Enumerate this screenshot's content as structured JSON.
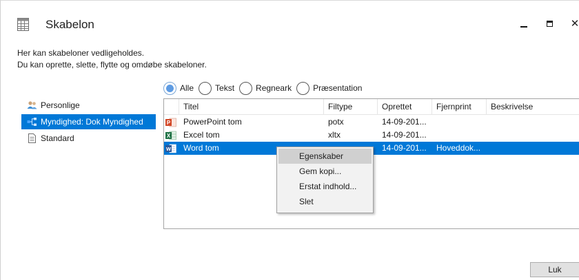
{
  "window": {
    "title": "Skabelon",
    "icon": "template-grid-icon",
    "controls": {
      "minimize": "minimize-icon",
      "maximize": "maximize-icon",
      "close": "✕"
    }
  },
  "intro": {
    "line1": "Her kan skabeloner vedligeholdes.",
    "line2": "Du kan oprette, slette, flytte og omdøbe skabeloner."
  },
  "filters": {
    "options": [
      {
        "label": "Alle",
        "checked": true
      },
      {
        "label": "Tekst",
        "checked": false
      },
      {
        "label": "Regneark",
        "checked": false
      },
      {
        "label": "Præsentation",
        "checked": false
      }
    ]
  },
  "tree": {
    "items": [
      {
        "label": "Personlige",
        "icon": "users-icon",
        "selected": false
      },
      {
        "label": "Myndighed: Dok Myndighed",
        "icon": "org-network-icon",
        "selected": true
      },
      {
        "label": "Standard",
        "icon": "document-icon",
        "selected": false
      }
    ]
  },
  "table": {
    "columns": [
      "Titel",
      "Filtype",
      "Oprettet",
      "Fjernprint",
      "Beskrivelse"
    ],
    "rows": [
      {
        "icon": "powerpoint-icon",
        "title": "PowerPoint tom",
        "type": "potx",
        "created": "14-09-201...",
        "remote": "",
        "description": "",
        "selected": false
      },
      {
        "icon": "excel-icon",
        "title": "Excel tom",
        "type": "xltx",
        "created": "14-09-201...",
        "remote": "",
        "description": "",
        "selected": false
      },
      {
        "icon": "word-icon",
        "title": "Word tom",
        "type": "",
        "created": "14-09-201...",
        "remote": "Hoveddok...",
        "description": "",
        "selected": true
      }
    ]
  },
  "context_menu": {
    "items": [
      {
        "label": "Egenskaber",
        "hover": true
      },
      {
        "label": "Gem kopi...",
        "hover": false
      },
      {
        "label": "Erstat indhold...",
        "hover": false
      },
      {
        "label": "Slet",
        "hover": false
      }
    ]
  },
  "footer": {
    "close_label": "Luk"
  },
  "colors": {
    "accent": "#0078d7",
    "radio_fill": "#5d9be3",
    "ppt": "#d24726",
    "excel": "#1e7145",
    "word": "#2b579a"
  }
}
